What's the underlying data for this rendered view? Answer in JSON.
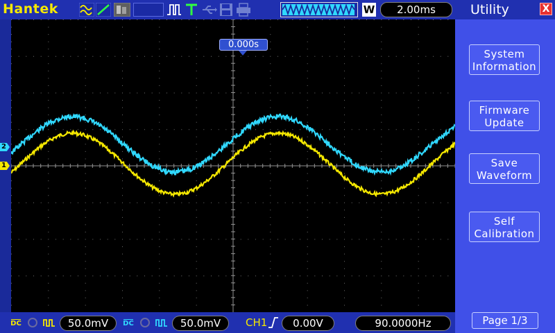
{
  "brand": "Hantek",
  "toolbar": {
    "icons": [
      "waveform-icon",
      "line-icon",
      "grey-icon",
      "pulse-icon",
      "trigger-t-icon",
      "usb-icon",
      "save-disk-icon",
      "print-icon"
    ],
    "timebase": "2.00ms",
    "window_badge": "W"
  },
  "trigger": {
    "position": "0.000s",
    "source": "CH1",
    "level": "0.00V",
    "frequency": "90.0000Hz"
  },
  "channels": {
    "ch1": {
      "label": "1",
      "coupling": "DC",
      "volts_div": "50.0mV",
      "color": "#f5e800"
    },
    "ch2": {
      "label": "2",
      "coupling": "DC",
      "volts_div": "50.0mV",
      "color": "#30d8ff"
    }
  },
  "menu": {
    "title": "Utility",
    "close": "X",
    "buttons": [
      {
        "line1": "System",
        "line2": "Information"
      },
      {
        "line1": "Firmware",
        "line2": "Update"
      },
      {
        "line1": "Save",
        "line2": "Waveform"
      },
      {
        "line1": "Self",
        "line2": "Calibration"
      }
    ],
    "page": "Page 1/3"
  },
  "colors": {
    "background": "#1a2a9a",
    "panel": "#4050e8",
    "ch1": "#f5e800",
    "ch2": "#30d8ff"
  }
}
